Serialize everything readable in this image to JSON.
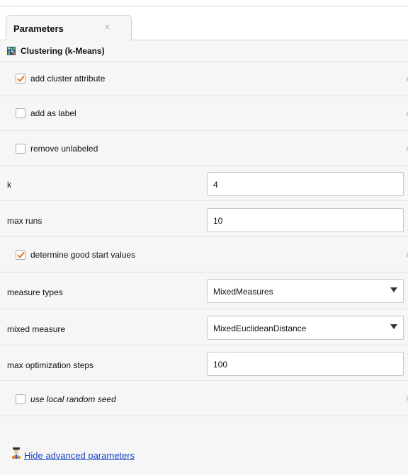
{
  "panel": {
    "tab_title": "Parameters",
    "tab_close_glyph": "×",
    "operator_title": "Clustering (k-Means)",
    "operator_icon": "clustering-icon"
  },
  "params": {
    "add_cluster_attribute": {
      "label": "add cluster attribute",
      "checked": true
    },
    "add_as_label": {
      "label": "add as label",
      "checked": false
    },
    "remove_unlabeled": {
      "label": "remove unlabeled",
      "checked": false
    },
    "k": {
      "label": "k",
      "value": "4"
    },
    "max_runs": {
      "label": "max runs",
      "value": "10"
    },
    "determine_good_start_values": {
      "label": "determine good start values",
      "checked": true
    },
    "measure_types": {
      "label": "measure types",
      "value": "MixedMeasures"
    },
    "mixed_measure": {
      "label": "mixed measure",
      "value": "MixedEuclideanDistance"
    },
    "max_optimization_steps": {
      "label": "max optimization steps",
      "value": "100"
    },
    "use_local_random_seed": {
      "label": "use local random seed",
      "checked": false
    }
  },
  "footer": {
    "link_label": "Hide advanced parameters",
    "icon": "expert-user-icon"
  },
  "colors": {
    "check_orange": "#e8711a",
    "link_blue": "#1a44c8"
  }
}
